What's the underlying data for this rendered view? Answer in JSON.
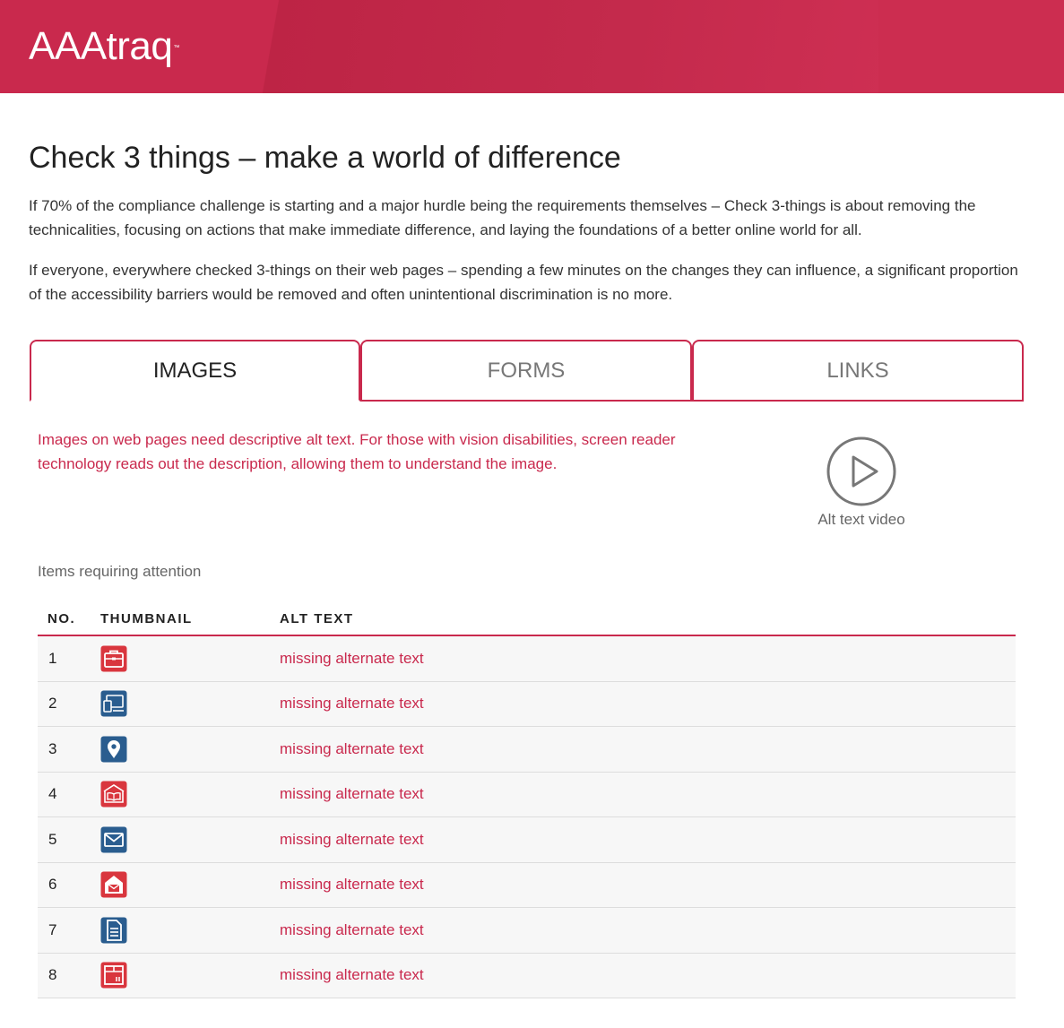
{
  "header": {
    "logo": "AAAtraq",
    "trademark": "™"
  },
  "intro": {
    "title": "Check 3 things – make a world of difference",
    "paragraph1": "If 70% of the compliance challenge is starting and a major hurdle being the requirements themselves – Check 3-things is about removing the technicalities, focusing on actions that make immediate difference, and laying the foundations of a better online world for all.",
    "paragraph2": "If everyone, everywhere checked 3-things on their web pages – spending a few minutes on the changes they can influence, a significant proportion of the accessibility barriers would be removed and often unintentional discrimination is no more."
  },
  "tabs": [
    {
      "label": "IMAGES",
      "active": true
    },
    {
      "label": "FORMS",
      "active": false
    },
    {
      "label": "LINKS",
      "active": false
    }
  ],
  "panel": {
    "description": "Images on web pages need descriptive alt text. For those with vision disabilities, screen reader technology reads out the description, allowing them to understand the image.",
    "video_label": "Alt text video",
    "attention_heading": "Items requiring attention"
  },
  "table": {
    "headers": {
      "no": "NO.",
      "thumbnail": "THUMBNAIL",
      "alt_text": "ALT TEXT"
    },
    "rows": [
      {
        "no": "1",
        "icon": "briefcase-icon",
        "color": "#d9363e",
        "alt": "missing alternate text"
      },
      {
        "no": "2",
        "icon": "devices-icon",
        "color": "#2a5d8f",
        "alt": "missing alternate text"
      },
      {
        "no": "3",
        "icon": "map-pin-icon",
        "color": "#2a5d8f",
        "alt": "missing alternate text"
      },
      {
        "no": "4",
        "icon": "open-book-icon",
        "color": "#d9363e",
        "alt": "missing alternate text"
      },
      {
        "no": "5",
        "icon": "envelope-icon",
        "color": "#2a5d8f",
        "alt": "missing alternate text"
      },
      {
        "no": "6",
        "icon": "mailbox-house-icon",
        "color": "#d9363e",
        "alt": "missing alternate text"
      },
      {
        "no": "7",
        "icon": "document-icon",
        "color": "#2a5d8f",
        "alt": "missing alternate text"
      },
      {
        "no": "8",
        "icon": "package-icon",
        "color": "#d9363e",
        "alt": "missing alternate text"
      }
    ]
  },
  "colors": {
    "brand": "#c9294d",
    "text": "#333333",
    "muted": "#666666"
  }
}
